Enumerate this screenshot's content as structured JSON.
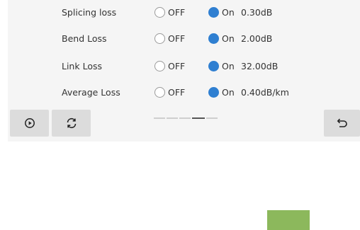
{
  "settings": {
    "off_label": "OFF",
    "on_label": "On",
    "rows": [
      {
        "label": "Splicing loss",
        "value": "0.30dB",
        "selected": "On"
      },
      {
        "label": "Bend Loss",
        "value": "2.00dB",
        "selected": "On"
      },
      {
        "label": "Link Loss",
        "value": "32.00dB",
        "selected": "On"
      },
      {
        "label": "Average Loss",
        "value": "0.40dB/km",
        "selected": "On"
      }
    ]
  },
  "toolbar": {
    "play_icon": "play-circle-icon",
    "refresh_icon": "refresh-icon",
    "back_icon": "return-icon",
    "pages": 5,
    "current_page": 4
  },
  "colors": {
    "accent": "#2f7fd1",
    "panel_bg": "#f5f5f5",
    "button_bg": "#dcdcdc",
    "green_block": "#8cb85c"
  }
}
